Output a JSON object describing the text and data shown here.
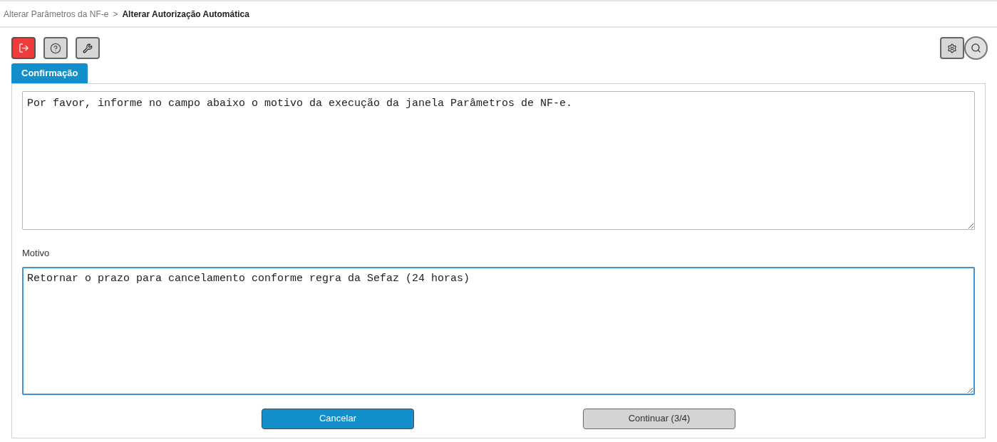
{
  "breadcrumb": {
    "parent": "Alterar Parâmetros da NF-e",
    "separator": ">",
    "current": "Alterar Autorização Automática"
  },
  "tabs": [
    {
      "label": "Confirmação",
      "selected": true
    }
  ],
  "message": "Por favor, informe no campo abaixo o motivo da execução da janela Parâmetros de NF-e.",
  "motivo": {
    "label": "Motivo",
    "value": "Retornar o prazo para cancelamento conforme regra da Sefaz (24 horas)"
  },
  "buttons": [
    {
      "label": "Cancelar",
      "kind": "primary"
    },
    {
      "label": "Continuar (3/4)",
      "kind": "secondary"
    }
  ]
}
